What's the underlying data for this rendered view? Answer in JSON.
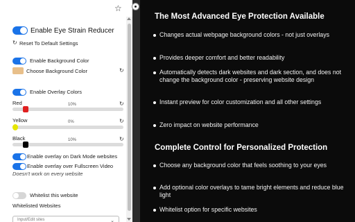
{
  "popup": {
    "header": {
      "title": "Enable Eye Strain Reducer",
      "reset": "Reset To Default Settings"
    },
    "background": {
      "enable_label": "Enable Background Color",
      "choose_label": "Choose Background Color",
      "swatch_color": "#e8bf8a"
    },
    "overlay": {
      "enable_label": "Enable Overlay Colors",
      "sliders": [
        {
          "name": "Red",
          "value": "10%",
          "level": 0.1,
          "color": "#e02020"
        },
        {
          "name": "Yellow",
          "value": "0%",
          "level": 0.0,
          "color": "#e6e600"
        },
        {
          "name": "Black",
          "value": "10%",
          "level": 0.1,
          "color": "#000000"
        }
      ],
      "dark_mode_label": "Enable overlay on Dark Mode websites",
      "fullscreen_label": "Enable overlay over Fullscreen Video",
      "fullscreen_note": "Doesn't work on every website"
    },
    "whitelist": {
      "label": "Whitelist this website",
      "list_title": "Whitelisted Websites",
      "input_placeholder": "Input/Edit sites"
    },
    "accent_color": "#1a73e8",
    "icons": {
      "star": "star-icon",
      "extension": "extension-icon",
      "reset": "reset-icon"
    }
  },
  "panel": {
    "section1": {
      "heading": "The Most Advanced Eye Protection Available",
      "bullets": [
        "Changes actual webpage background colors - not just overlays",
        "Provides deeper comfort and better readability",
        "Automatically detects dark websites and dark section, and does not change the background color - preserving website design",
        "Instant preview for color customization and all other settings",
        "Zero impact on website performance"
      ]
    },
    "section2": {
      "heading": "Complete Control for Personalized Protection",
      "bullets": [
        "Choose any background color that feels soothing to your eyes",
        "Add optional color overlays to tame bright elements and reduce blue light",
        "Whitelist option for specific websites"
      ]
    }
  }
}
